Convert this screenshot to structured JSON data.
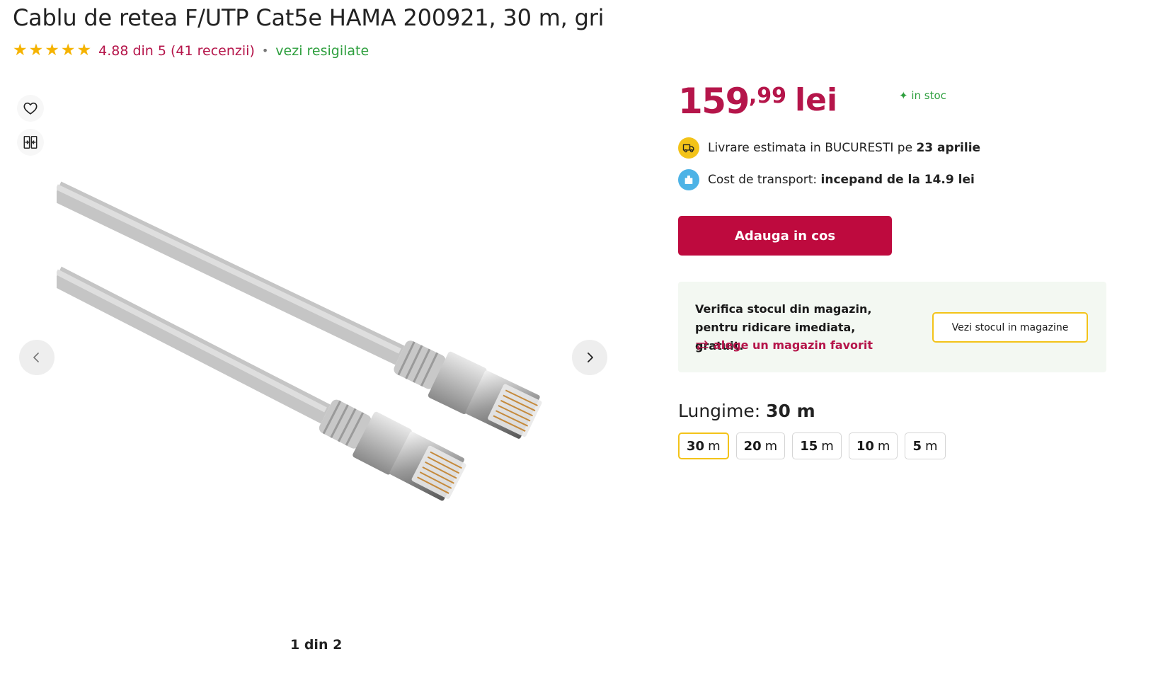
{
  "product": {
    "title": "Cablu de retea F/UTP Cat5e HAMA 200921, 30 m, gri"
  },
  "rating": {
    "stars": 5,
    "text": "4.88 din 5 (41 recenzii)",
    "separator": "•",
    "resigilate_link": "vezi resigilate"
  },
  "gallery": {
    "counter": "1 din 2",
    "icons": [
      "heart-icon",
      "compare-icon",
      "chevron-left-icon",
      "chevron-right-icon"
    ]
  },
  "price": {
    "integer": "159",
    "decimal": ",99",
    "currency": "lei"
  },
  "stock": {
    "label": "in stoc"
  },
  "delivery": {
    "prefix": "Livrare estimata in BUCURESTI pe",
    "date": "23 aprilie"
  },
  "transport": {
    "prefix": "Cost de transport:",
    "value": "incepand de la 14.9 lei"
  },
  "cart": {
    "button_label": "Adauga in cos"
  },
  "store_check": {
    "text": "Verifica stocul din magazin, pentru ridicare imediata, gratuit.",
    "favorite_link": "alege un magazin favorit",
    "button_label": "Vezi stocul in magazine"
  },
  "length": {
    "label": "Lungime:",
    "selected": "30 m",
    "options": [
      {
        "value": "30",
        "unit": "m"
      },
      {
        "value": "20",
        "unit": "m"
      },
      {
        "value": "15",
        "unit": "m"
      },
      {
        "value": "10",
        "unit": "m"
      },
      {
        "value": "5",
        "unit": "m"
      }
    ]
  },
  "colors": {
    "brand_red": "#be0a3e",
    "rating_pink": "#b5154a",
    "stock_green": "#2e9f3e",
    "star_yellow": "#f5b301",
    "highlight_yellow": "#f3c319"
  }
}
